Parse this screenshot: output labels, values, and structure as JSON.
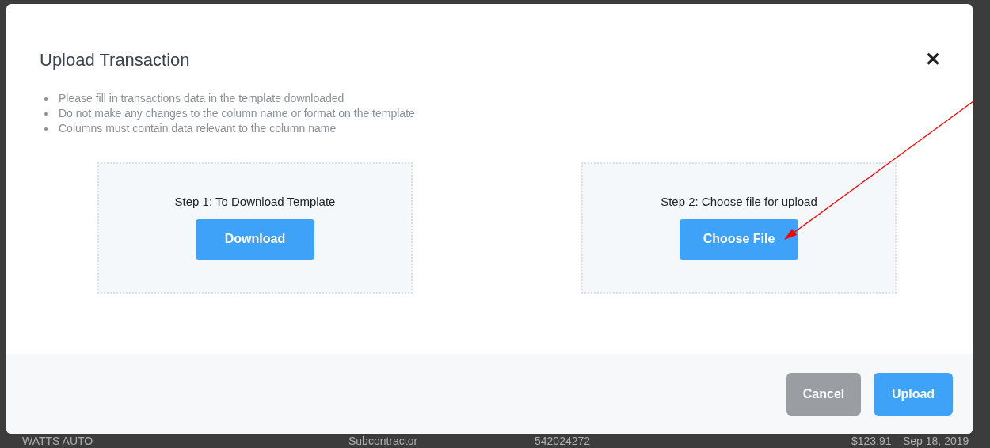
{
  "dialog": {
    "title": "Upload Transaction",
    "close": "✕",
    "instructions": [
      "Please fill in transactions data in the template downloaded",
      "Do not make any changes to the column name or format on the template",
      "Columns must contain data relevant to the column name"
    ],
    "steps": [
      {
        "label": "Step 1: To Download Template",
        "button": "Download"
      },
      {
        "label": "Step 2: Choose file for upload",
        "button": "Choose File"
      }
    ],
    "buttons": [
      {
        "label": "Cancel",
        "kind": "secondary"
      },
      {
        "label": "Upload",
        "kind": "primary"
      }
    ]
  },
  "background_row": [
    "WATTS AUTO",
    "Subcontractor",
    "542024272",
    "$123.91",
    "Sep 18, 2019"
  ]
}
